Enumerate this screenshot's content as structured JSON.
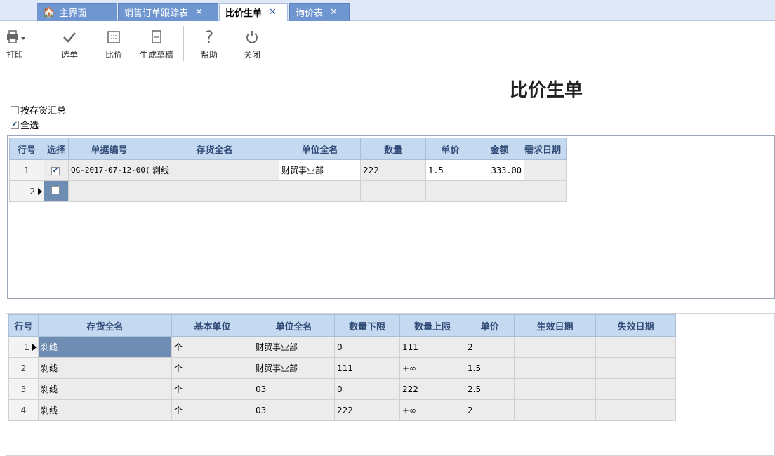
{
  "tabs": [
    {
      "label": "主界面"
    },
    {
      "label": "销售订单跟踪表"
    },
    {
      "label": "比价生单"
    },
    {
      "label": "询价表"
    }
  ],
  "toolbar": {
    "print": "打印",
    "select": "选单",
    "compare": "比价",
    "draft": "生成草稿",
    "help": "帮助",
    "close": "关闭"
  },
  "page": {
    "title": "比价生单",
    "summary_label": "按存货汇总",
    "select_all_label": "全选",
    "summary_checked": false,
    "select_all_checked": true
  },
  "top_grid": {
    "columns": [
      "行号",
      "选择",
      "单据编号",
      "存货全名",
      "单位全名",
      "数量",
      "单价",
      "金额",
      "需求日期"
    ],
    "rows": [
      {
        "rownum": "1",
        "checked": true,
        "doc_no": "QG-2017-07-12-00(",
        "item": "刹线",
        "unit": "财贸事业部",
        "qty": "222",
        "price": "1.5",
        "amount": "333.00",
        "date": ""
      },
      {
        "rownum": "2",
        "checked": false,
        "doc_no": "",
        "item": "",
        "unit": "",
        "qty": "",
        "price": "",
        "amount": "",
        "date": ""
      }
    ]
  },
  "bottom_grid": {
    "columns": [
      "行号",
      "存货全名",
      "基本单位",
      "单位全名",
      "数量下限",
      "数量上限",
      "单价",
      "生效日期",
      "失效日期"
    ],
    "rows": [
      {
        "rownum": "1",
        "item": "刹线",
        "base_unit": "个",
        "unit": "财贸事业部",
        "min": "0",
        "max": "111",
        "price": "2",
        "start": "",
        "end": ""
      },
      {
        "rownum": "2",
        "item": "刹线",
        "base_unit": "个",
        "unit": "财贸事业部",
        "min": "111",
        "max": "+∞",
        "price": "1.5",
        "start": "",
        "end": ""
      },
      {
        "rownum": "3",
        "item": "刹线",
        "base_unit": "个",
        "unit": "03",
        "min": "0",
        "max": "222",
        "price": "2.5",
        "start": "",
        "end": ""
      },
      {
        "rownum": "4",
        "item": "刹线",
        "base_unit": "个",
        "unit": "03",
        "min": "222",
        "max": "+∞",
        "price": "2",
        "start": "",
        "end": ""
      }
    ]
  }
}
